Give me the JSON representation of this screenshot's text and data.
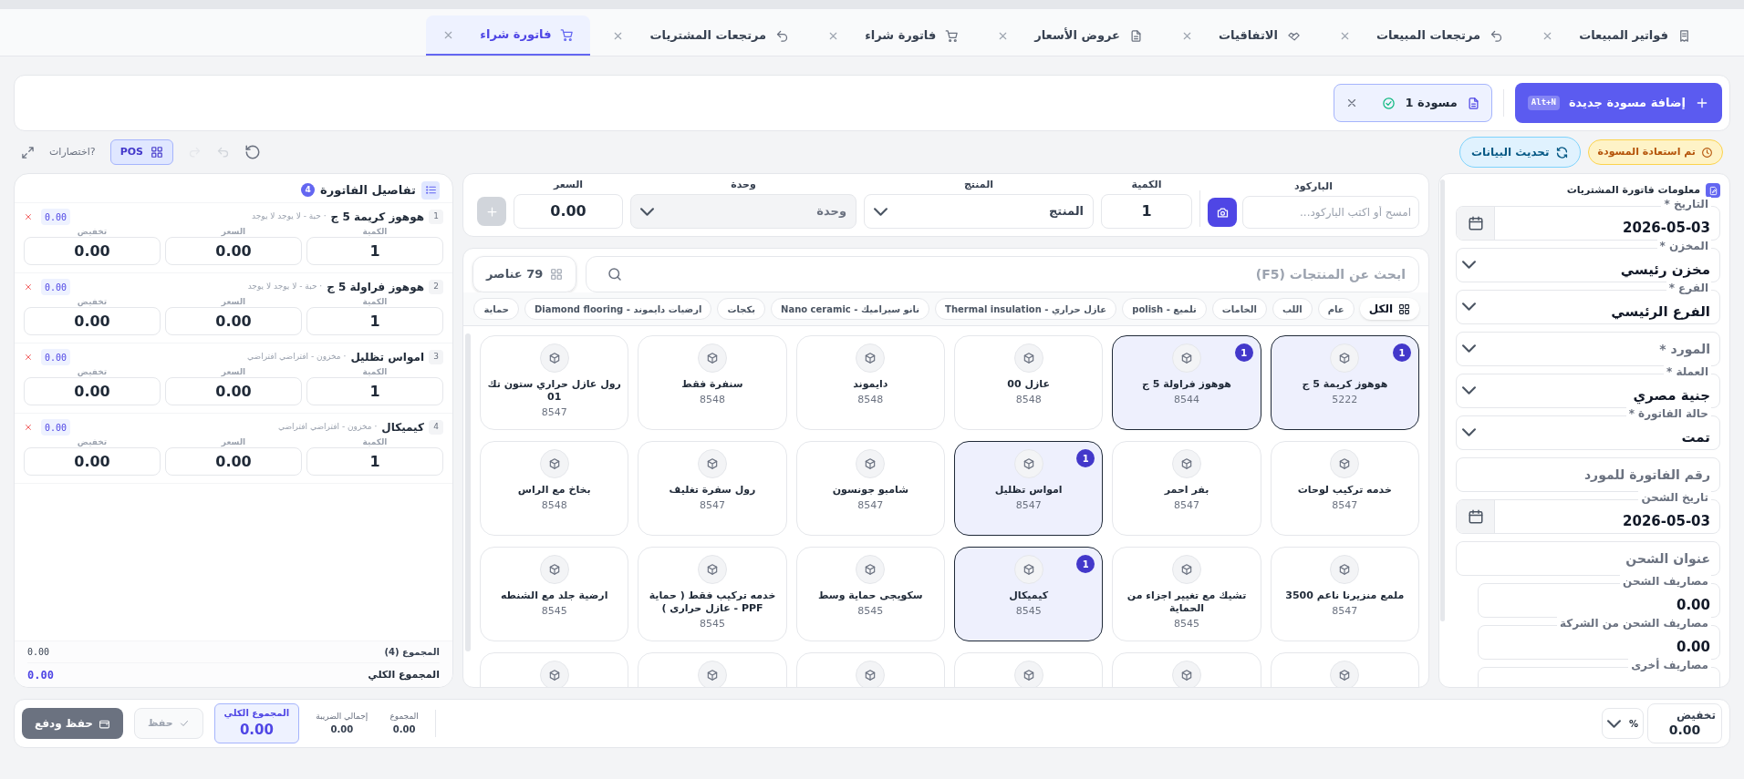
{
  "tabs": [
    {
      "label": "فواتير المبيعات",
      "selected": false
    },
    {
      "label": "مرتجعات المبيعات",
      "selected": false
    },
    {
      "label": "الاتفاقيات",
      "selected": false
    },
    {
      "label": "عروض الأسعار",
      "selected": false
    },
    {
      "label": "فاتورة شراء",
      "selected": false
    },
    {
      "label": "مرتجعات المشتريات",
      "selected": false
    },
    {
      "label": "فاتورة شراء",
      "selected": true
    }
  ],
  "drafts": {
    "add_button": {
      "label": "إضافة مسودة جديدة",
      "shortcut": "Alt+N"
    },
    "items": [
      {
        "label": "مسودة 1",
        "saved": true,
        "selected": true
      }
    ]
  },
  "toolbar": {
    "restored_badge": "تم استعادة المسودة",
    "refresh_button": "تحديث البيانات",
    "pos_button": "POS",
    "shortcuts_link": "?اختصارات"
  },
  "purchase_info": {
    "title": "معلومات فاتورة المشتريات",
    "fields": [
      {
        "kind": "date",
        "label": "التاريخ *",
        "value": "2026-05-03"
      },
      {
        "kind": "select",
        "label": "المخزن *",
        "value": "مخزن رئيسي"
      },
      {
        "kind": "select",
        "label": "الفرع *",
        "value": "الفرع الرئيسي"
      },
      {
        "kind": "select",
        "placeholder": "المورد *"
      },
      {
        "kind": "select",
        "label": "العملة *",
        "value": "جنية مصري"
      },
      {
        "kind": "select",
        "label": "حالة الفاتورة *",
        "value": "تمت"
      },
      {
        "kind": "text",
        "placeholder": "رقم الفاتورة للمورد"
      },
      {
        "kind": "date",
        "label": "تاريخ الشحن",
        "value": "2026-05-03"
      },
      {
        "kind": "text",
        "placeholder": "عنوان الشحن"
      },
      {
        "kind": "number",
        "label": "مصاريف الشحن",
        "value": "0.00"
      },
      {
        "kind": "number",
        "label": "مصاريف الشحن من الشركة",
        "value": "0.00"
      },
      {
        "kind": "number",
        "label": "مصاريف أخرى"
      }
    ]
  },
  "entry": {
    "barcode": {
      "label": "الباركود",
      "placeholder": "امسح أو اكتب الباركود..."
    },
    "quantity": {
      "label": "الكمية",
      "value": "1"
    },
    "product": {
      "label": "المنتج",
      "placeholder": "المنتج"
    },
    "unit": {
      "label": "وحدة",
      "placeholder": "وحدة",
      "disabled": true
    },
    "price": {
      "label": "السعر",
      "value": "0.00"
    },
    "add_disabled": true
  },
  "catalog": {
    "search_placeholder": "ابحث عن المنتجات (F5)",
    "count_button": "79 عناصر",
    "categories": [
      {
        "label": "الكل",
        "selected": true
      },
      {
        "label": "عام",
        "selected": false
      },
      {
        "label": "اللب",
        "selected": false
      },
      {
        "label": "الخامات",
        "selected": false
      },
      {
        "label": "تلميع - polish",
        "selected": false
      },
      {
        "label": "عازل حراري - Thermal insulation",
        "selected": false
      },
      {
        "label": "نانو سيراميك - Nano ceramic",
        "selected": false
      },
      {
        "label": "بكجات",
        "selected": false
      },
      {
        "label": "ارضيات دايموند - Diamond flooring",
        "selected": false
      },
      {
        "label": "حماية",
        "selected": false
      }
    ],
    "products": [
      {
        "kind": "full",
        "name": "هوهوز كريمة 5 ج",
        "code": "5222",
        "selected": true,
        "count": "1"
      },
      {
        "kind": "full",
        "name": "هوهوز فراولة 5 ج",
        "code": "8544",
        "selected": true,
        "count": "1"
      },
      {
        "kind": "full",
        "name": "عازل 00",
        "code": "8548",
        "selected": false
      },
      {
        "kind": "full",
        "name": "دايموند",
        "code": "8548",
        "selected": false
      },
      {
        "kind": "full",
        "name": "سنفرة فقط",
        "code": "8548",
        "selected": false
      },
      {
        "kind": "full",
        "name": "رول عازل حراري ستون تك 01",
        "code": "8547",
        "selected": false
      },
      {
        "kind": "full",
        "name": "خدمه تركيب لوحات",
        "code": "8547",
        "selected": false
      },
      {
        "kind": "full",
        "name": "بفر احمر",
        "code": "8547",
        "selected": false
      },
      {
        "kind": "full",
        "name": "امواس تظليل",
        "code": "8547",
        "selected": true,
        "count": "1"
      },
      {
        "kind": "full",
        "name": "شامبو جونسون",
        "code": "8547",
        "selected": false
      },
      {
        "kind": "full",
        "name": "رول سفرة تغليف",
        "code": "8547",
        "selected": false
      },
      {
        "kind": "full",
        "name": "بخاخ مع الراس",
        "code": "8548",
        "selected": false
      },
      {
        "kind": "full",
        "name": "ملمع منزيرنا ناعم 3500",
        "code": "8547",
        "selected": false
      },
      {
        "kind": "full",
        "name": "تشيك مع تغيير اجزاء من الحماية",
        "code": "8545",
        "selected": false
      },
      {
        "kind": "full",
        "name": "كيميكال",
        "code": "8545",
        "selected": true,
        "count": "1"
      },
      {
        "kind": "full",
        "name": "سكويجى حماية وسط",
        "code": "8545",
        "selected": false
      },
      {
        "kind": "full",
        "name": "خدمه تركيب فقط ( حماية PPF - عازل حرارى )",
        "code": "8545",
        "selected": false
      },
      {
        "kind": "full",
        "name": "ارضية جلد مع الشنطه",
        "code": "8545",
        "selected": false
      },
      {
        "kind": "partial"
      },
      {
        "kind": "partial"
      },
      {
        "kind": "partial"
      },
      {
        "kind": "partial"
      },
      {
        "kind": "partial"
      },
      {
        "kind": "partial"
      }
    ]
  },
  "invoice_details": {
    "title": "تفاصيل الفاتورة",
    "count": "4",
    "lines": [
      {
        "index": "1",
        "name": "هوهوز كريمة 5 ج",
        "meta": "· حبة - لا يوجد لا يوجد",
        "total": "0.00",
        "fields": [
          {
            "label": "الكمية",
            "value": "1"
          },
          {
            "label": "السعر",
            "value": "0.00"
          },
          {
            "label": "تخفيض",
            "value": "0.00"
          }
        ]
      },
      {
        "index": "2",
        "name": "هوهوز فراولة 5 ج",
        "meta": "· حبة - لا يوجد لا يوجد",
        "total": "0.00",
        "fields": [
          {
            "label": "الكمية",
            "value": "1"
          },
          {
            "label": "السعر",
            "value": "0.00"
          },
          {
            "label": "تخفيض",
            "value": "0.00"
          }
        ]
      },
      {
        "index": "3",
        "name": "امواس تظليل",
        "meta": "· مخزون - افتراضي افتراضي",
        "total": "0.00",
        "fields": [
          {
            "label": "الكمية",
            "value": "1"
          },
          {
            "label": "السعر",
            "value": "0.00"
          },
          {
            "label": "تخفيض",
            "value": "0.00"
          }
        ]
      },
      {
        "index": "4",
        "name": "كيميكال",
        "meta": "· مخزون - افتراضي افتراضي",
        "total": "0.00",
        "fields": [
          {
            "label": "الكمية",
            "value": "1"
          },
          {
            "label": "السعر",
            "value": "0.00"
          },
          {
            "label": "تخفيض",
            "value": "0.00"
          }
        ]
      }
    ],
    "subtotal": {
      "label": "المجموع (4)",
      "value": "0.00"
    },
    "grand_total": {
      "label": "المجموع الكلي",
      "value": "0.00"
    }
  },
  "footer": {
    "discount": {
      "label": "تخفيض",
      "value": "0.00",
      "type": "%"
    },
    "summary": [
      {
        "label": "المجموع",
        "value": "0.00",
        "highlight": false
      },
      {
        "label": "إجمالي الضريبة",
        "value": "0.00",
        "highlight": false
      },
      {
        "label": "المجموع الكلي",
        "value": "0.00",
        "highlight": true
      }
    ],
    "save_button": {
      "label": "حفظ",
      "disabled": true
    },
    "save_pay_button": {
      "label": "حفظ ودفع"
    }
  }
}
